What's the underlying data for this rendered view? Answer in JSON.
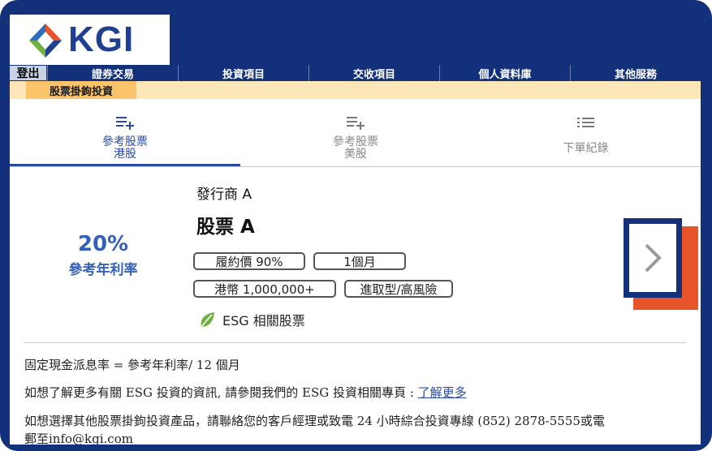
{
  "brand": {
    "logo_text": "KGI"
  },
  "nav": {
    "login_label": "登出",
    "items": [
      "證券交易",
      "投資項目",
      "交收項目",
      "個人資料庫",
      "其他服務"
    ]
  },
  "subnav": {
    "active_label": "股票掛鉤投資"
  },
  "tabs": [
    {
      "label": "參考股票\n港股",
      "icon": "list-add-icon",
      "active": true
    },
    {
      "label": "參考股票\n美股",
      "icon": "list-add-icon",
      "active": false
    },
    {
      "label": "下單紀錄",
      "icon": "list-icon",
      "active": false
    }
  ],
  "product": {
    "rate_value": "20%",
    "rate_label": "參考年利率",
    "issuer": "發行商 A",
    "name": "股票 A",
    "chips": [
      "履約價 90%",
      "1個月",
      "港幣 1,000,000+",
      "進取型/高風險"
    ],
    "esg_label": "ESG 相關股票",
    "next_icon": "chevron-right-icon"
  },
  "info": {
    "line1": "固定現金派息率 = 參考年利率/ 12 個月",
    "line2_prefix": "如想了解更多有關 ESG 投資的資訊, 請參閱我們的 ESG 投資相關專頁 : ",
    "line2_link": "了解更多",
    "line3": "如想選擇其他股票掛鉤投資產品，請聯絡您的客戶經理或致電 24 小時綜合投資專線 (852) 2878-5555或電",
    "line4": "郵至info@kgi.com"
  },
  "colors": {
    "navy": "#13307a",
    "accent_blue": "#3560b8",
    "orange": "#e8542a",
    "subnav_bg": "#fde7b8",
    "subnav_active": "#fbc46a"
  }
}
